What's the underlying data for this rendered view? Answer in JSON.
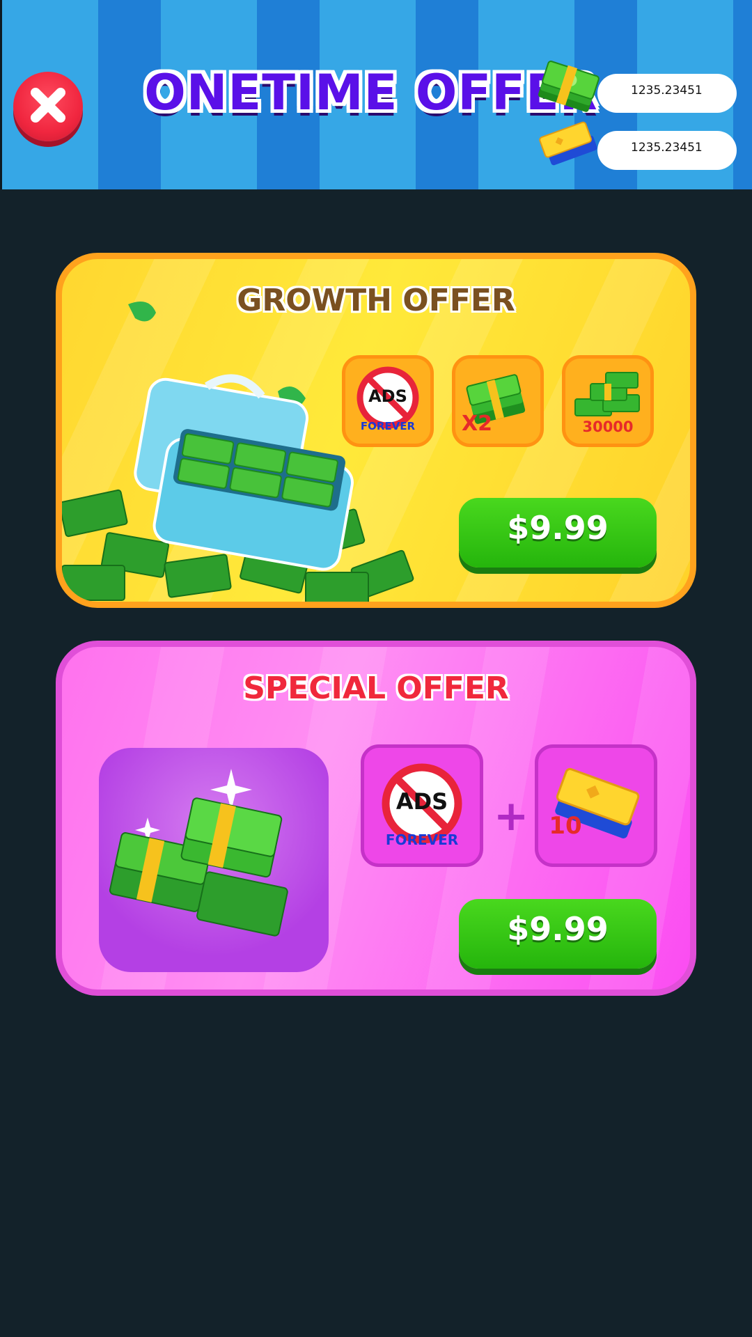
{
  "header": {
    "title": "ONETIME OFFER",
    "currency_cash": "1235.23451",
    "currency_tickets": "1235.23451"
  },
  "growth_offer": {
    "title": "GROWTH OFFER",
    "items": [
      {
        "icon": "no-ads-icon",
        "label_top": "ADS",
        "label_bottom": "FOREVER"
      },
      {
        "icon": "cash-stack-icon",
        "label": "X2"
      },
      {
        "icon": "cash-pile-icon",
        "label": "30000"
      }
    ],
    "price": "$9.99"
  },
  "special_offer": {
    "title": "SPECIAL OFFER",
    "items": [
      {
        "icon": "no-ads-icon",
        "label_top": "ADS",
        "label_bottom": "FOREVER"
      },
      {
        "icon": "ticket-icon",
        "label": "10"
      }
    ],
    "price": "$9.99"
  },
  "colors": {
    "background": "#13222a",
    "header_stripe_light": "#36a7e6",
    "header_stripe_dark": "#1f7fd6",
    "title_purple": "#5a10e8",
    "growth_card": "#ffe93a",
    "special_card": "#ff8ff3",
    "button_green": "#2fbe10",
    "close_red": "#f0263f"
  }
}
